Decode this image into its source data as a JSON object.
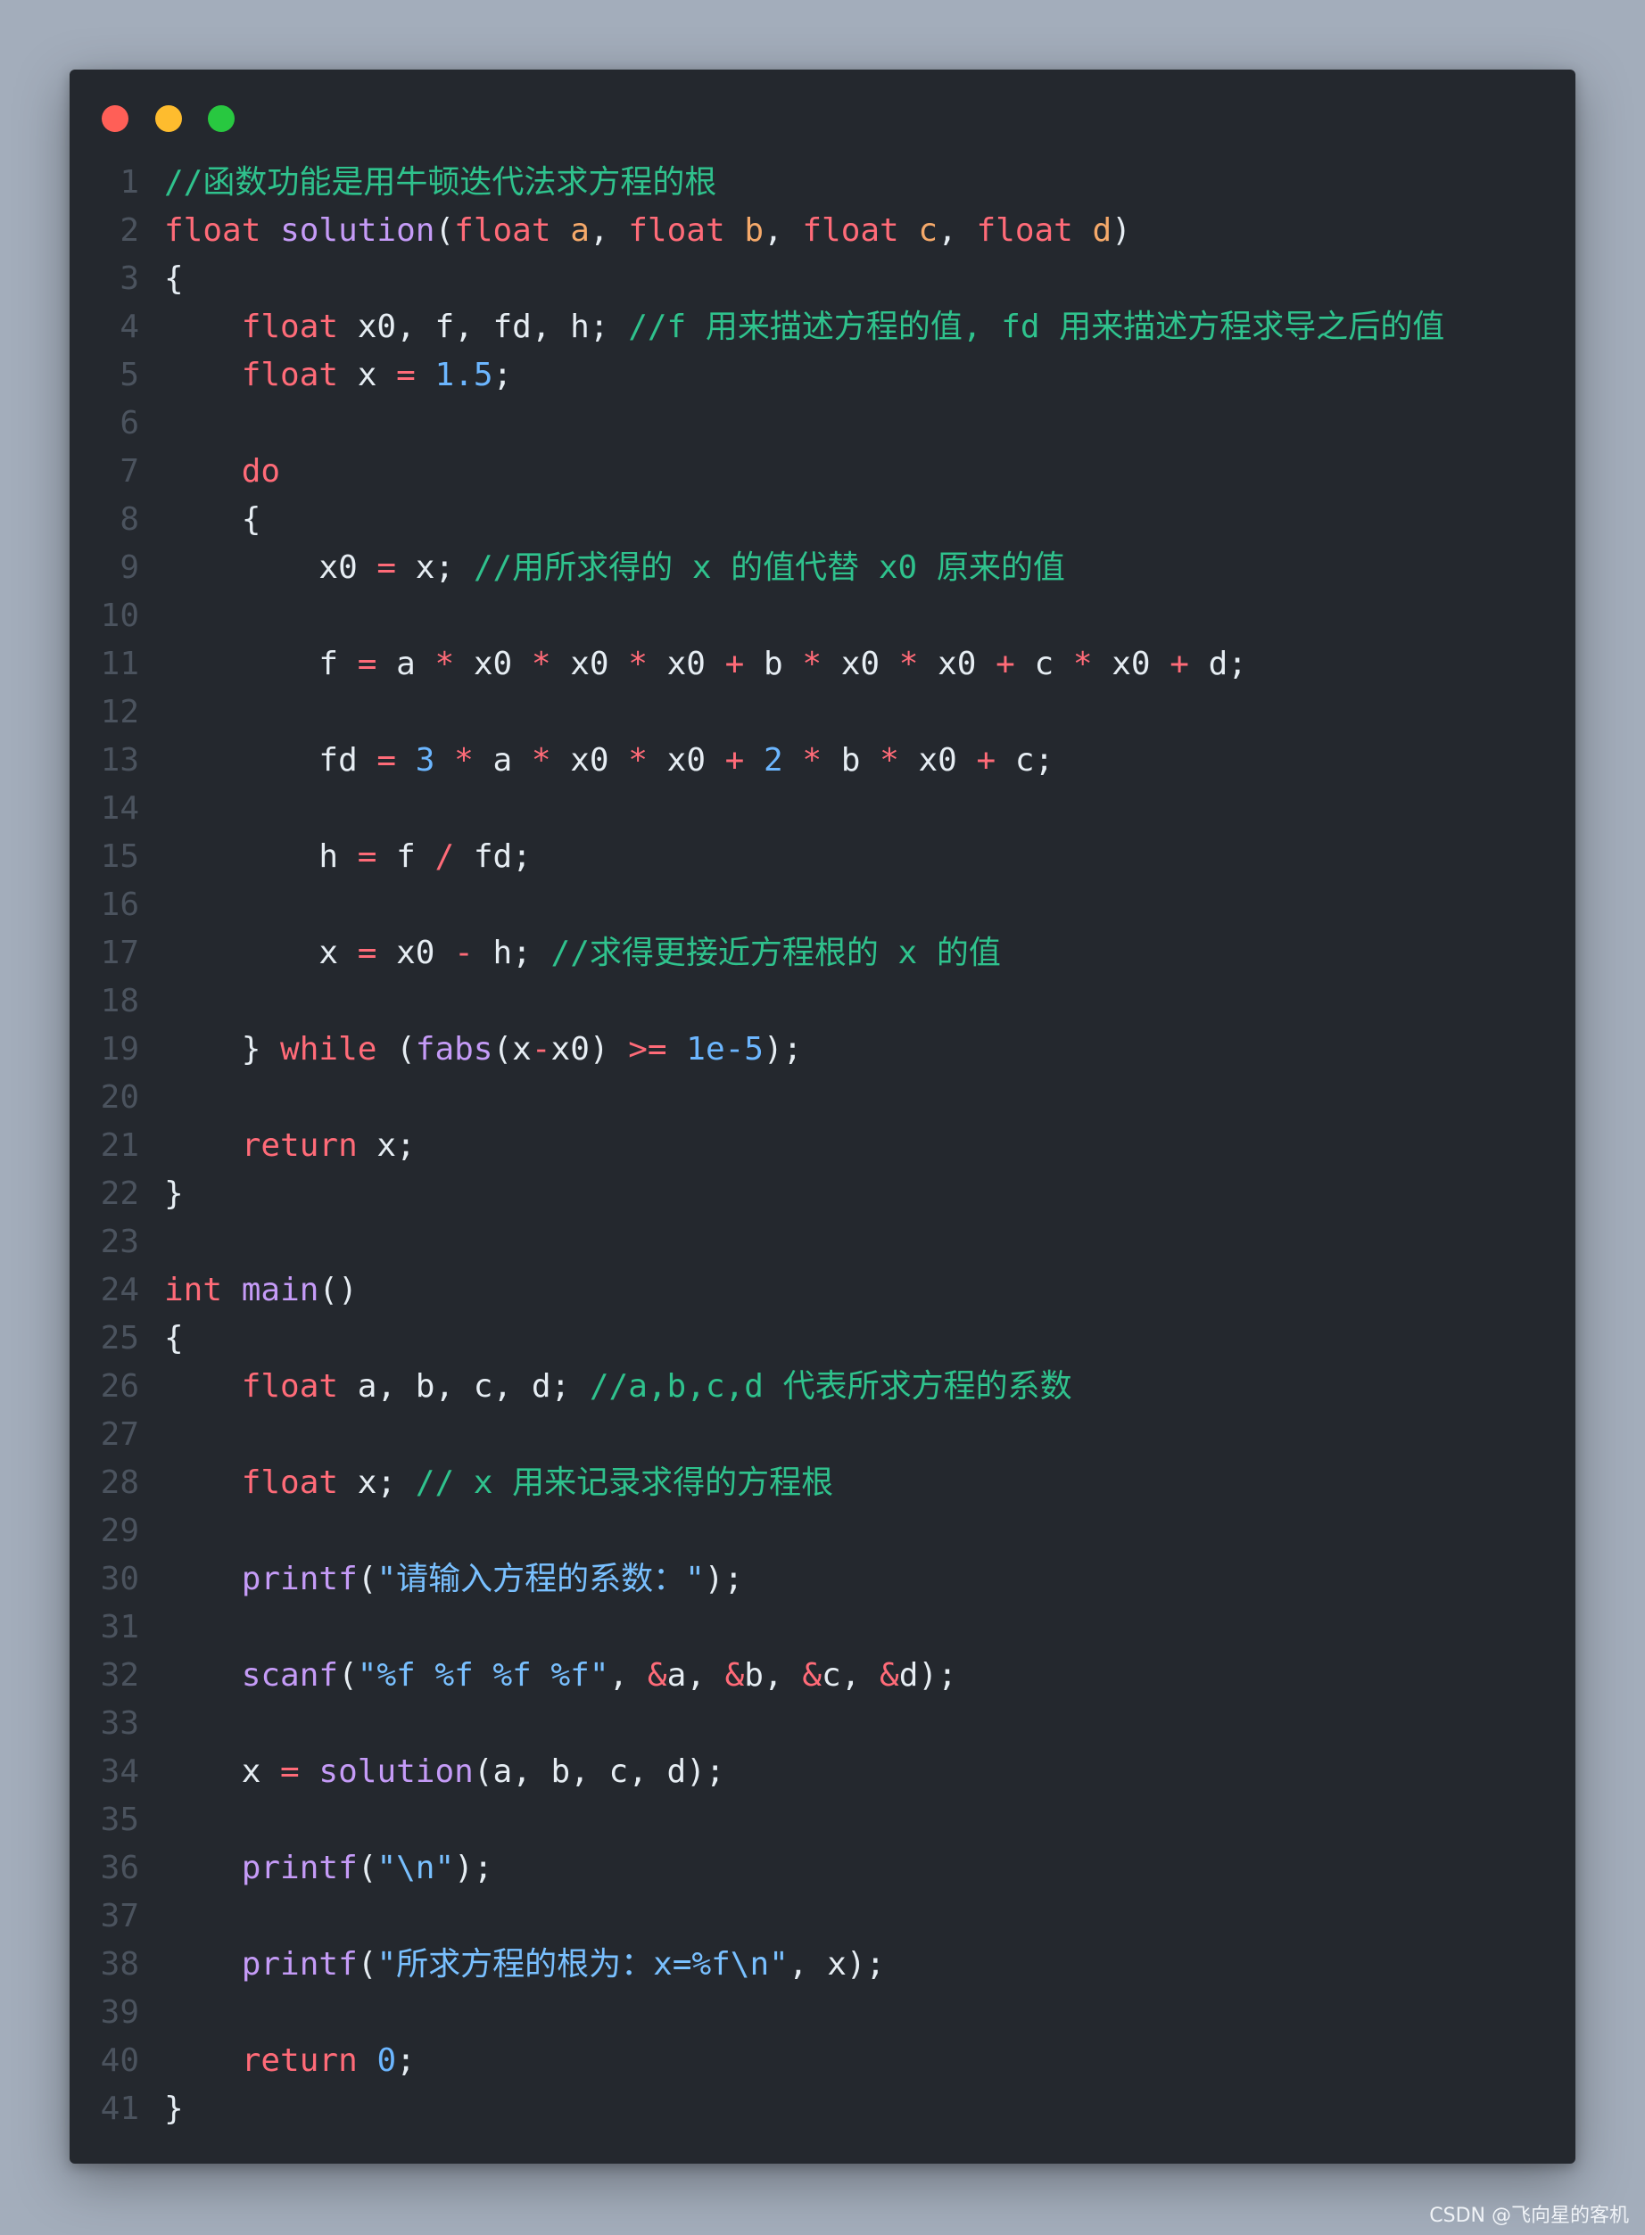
{
  "window": {
    "controls": [
      "close",
      "minimize",
      "maximize"
    ]
  },
  "code_lines": [
    [
      {
        "t": "//函数功能是用牛顿迭代法求方程的根",
        "c": "cm"
      }
    ],
    [
      {
        "t": "float",
        "c": "kw"
      },
      {
        "t": " ",
        "c": "plain"
      },
      {
        "t": "solution",
        "c": "fn"
      },
      {
        "t": "(",
        "c": "plain"
      },
      {
        "t": "float",
        "c": "kw"
      },
      {
        "t": " ",
        "c": "plain"
      },
      {
        "t": "a",
        "c": "param"
      },
      {
        "t": ", ",
        "c": "plain"
      },
      {
        "t": "float",
        "c": "kw"
      },
      {
        "t": " ",
        "c": "plain"
      },
      {
        "t": "b",
        "c": "param"
      },
      {
        "t": ", ",
        "c": "plain"
      },
      {
        "t": "float",
        "c": "kw"
      },
      {
        "t": " ",
        "c": "plain"
      },
      {
        "t": "c",
        "c": "param"
      },
      {
        "t": ", ",
        "c": "plain"
      },
      {
        "t": "float",
        "c": "kw"
      },
      {
        "t": " ",
        "c": "plain"
      },
      {
        "t": "d",
        "c": "param"
      },
      {
        "t": ")",
        "c": "plain"
      }
    ],
    [
      {
        "t": "{",
        "c": "plain"
      }
    ],
    [
      {
        "t": "    ",
        "c": "plain"
      },
      {
        "t": "float",
        "c": "kw"
      },
      {
        "t": " x0, f, fd, h; ",
        "c": "plain"
      },
      {
        "t": "//f 用来描述方程的值, fd 用来描述方程求导之后的值",
        "c": "cm"
      }
    ],
    [
      {
        "t": "    ",
        "c": "plain"
      },
      {
        "t": "float",
        "c": "kw"
      },
      {
        "t": " x ",
        "c": "plain"
      },
      {
        "t": "=",
        "c": "op"
      },
      {
        "t": " ",
        "c": "plain"
      },
      {
        "t": "1.5",
        "c": "num"
      },
      {
        "t": ";",
        "c": "plain"
      }
    ],
    [],
    [
      {
        "t": "    ",
        "c": "plain"
      },
      {
        "t": "do",
        "c": "kw"
      }
    ],
    [
      {
        "t": "    {",
        "c": "plain"
      }
    ],
    [
      {
        "t": "        x0 ",
        "c": "plain"
      },
      {
        "t": "=",
        "c": "op"
      },
      {
        "t": " x; ",
        "c": "plain"
      },
      {
        "t": "//用所求得的 x 的值代替 x0 原来的值",
        "c": "cm"
      }
    ],
    [],
    [
      {
        "t": "        f ",
        "c": "plain"
      },
      {
        "t": "=",
        "c": "op"
      },
      {
        "t": " a ",
        "c": "plain"
      },
      {
        "t": "*",
        "c": "op"
      },
      {
        "t": " x0 ",
        "c": "plain"
      },
      {
        "t": "*",
        "c": "op"
      },
      {
        "t": " x0 ",
        "c": "plain"
      },
      {
        "t": "*",
        "c": "op"
      },
      {
        "t": " x0 ",
        "c": "plain"
      },
      {
        "t": "+",
        "c": "op"
      },
      {
        "t": " b ",
        "c": "plain"
      },
      {
        "t": "*",
        "c": "op"
      },
      {
        "t": " x0 ",
        "c": "plain"
      },
      {
        "t": "*",
        "c": "op"
      },
      {
        "t": " x0 ",
        "c": "plain"
      },
      {
        "t": "+",
        "c": "op"
      },
      {
        "t": " c ",
        "c": "plain"
      },
      {
        "t": "*",
        "c": "op"
      },
      {
        "t": " x0 ",
        "c": "plain"
      },
      {
        "t": "+",
        "c": "op"
      },
      {
        "t": " d;",
        "c": "plain"
      }
    ],
    [],
    [
      {
        "t": "        fd ",
        "c": "plain"
      },
      {
        "t": "=",
        "c": "op"
      },
      {
        "t": " ",
        "c": "plain"
      },
      {
        "t": "3",
        "c": "num"
      },
      {
        "t": " ",
        "c": "plain"
      },
      {
        "t": "*",
        "c": "op"
      },
      {
        "t": " a ",
        "c": "plain"
      },
      {
        "t": "*",
        "c": "op"
      },
      {
        "t": " x0 ",
        "c": "plain"
      },
      {
        "t": "*",
        "c": "op"
      },
      {
        "t": " x0 ",
        "c": "plain"
      },
      {
        "t": "+",
        "c": "op"
      },
      {
        "t": " ",
        "c": "plain"
      },
      {
        "t": "2",
        "c": "num"
      },
      {
        "t": " ",
        "c": "plain"
      },
      {
        "t": "*",
        "c": "op"
      },
      {
        "t": " b ",
        "c": "plain"
      },
      {
        "t": "*",
        "c": "op"
      },
      {
        "t": " x0 ",
        "c": "plain"
      },
      {
        "t": "+",
        "c": "op"
      },
      {
        "t": " c;",
        "c": "plain"
      }
    ],
    [],
    [
      {
        "t": "        h ",
        "c": "plain"
      },
      {
        "t": "=",
        "c": "op"
      },
      {
        "t": " f ",
        "c": "plain"
      },
      {
        "t": "/",
        "c": "op"
      },
      {
        "t": " fd;",
        "c": "plain"
      }
    ],
    [],
    [
      {
        "t": "        x ",
        "c": "plain"
      },
      {
        "t": "=",
        "c": "op"
      },
      {
        "t": " x0 ",
        "c": "plain"
      },
      {
        "t": "-",
        "c": "op"
      },
      {
        "t": " h; ",
        "c": "plain"
      },
      {
        "t": "//求得更接近方程根的 x 的值",
        "c": "cm"
      }
    ],
    [],
    [
      {
        "t": "    } ",
        "c": "plain"
      },
      {
        "t": "while",
        "c": "kw"
      },
      {
        "t": " (",
        "c": "plain"
      },
      {
        "t": "fabs",
        "c": "fn"
      },
      {
        "t": "(x",
        "c": "plain"
      },
      {
        "t": "-",
        "c": "op"
      },
      {
        "t": "x0) ",
        "c": "plain"
      },
      {
        "t": ">=",
        "c": "op"
      },
      {
        "t": " ",
        "c": "plain"
      },
      {
        "t": "1e-5",
        "c": "num"
      },
      {
        "t": ");",
        "c": "plain"
      }
    ],
    [],
    [
      {
        "t": "    ",
        "c": "plain"
      },
      {
        "t": "return",
        "c": "kw"
      },
      {
        "t": " x;",
        "c": "plain"
      }
    ],
    [
      {
        "t": "}",
        "c": "plain"
      }
    ],
    [],
    [
      {
        "t": "int",
        "c": "kw"
      },
      {
        "t": " ",
        "c": "plain"
      },
      {
        "t": "main",
        "c": "fn"
      },
      {
        "t": "()",
        "c": "plain"
      }
    ],
    [
      {
        "t": "{",
        "c": "plain"
      }
    ],
    [
      {
        "t": "    ",
        "c": "plain"
      },
      {
        "t": "float",
        "c": "kw"
      },
      {
        "t": " a, b, c, d; ",
        "c": "plain"
      },
      {
        "t": "//a,b,c,d 代表所求方程的系数",
        "c": "cm"
      }
    ],
    [],
    [
      {
        "t": "    ",
        "c": "plain"
      },
      {
        "t": "float",
        "c": "kw"
      },
      {
        "t": " x; ",
        "c": "plain"
      },
      {
        "t": "// x 用来记录求得的方程根",
        "c": "cm"
      }
    ],
    [],
    [
      {
        "t": "    ",
        "c": "plain"
      },
      {
        "t": "printf",
        "c": "fn"
      },
      {
        "t": "(",
        "c": "plain"
      },
      {
        "t": "\"请输入方程的系数：\"",
        "c": "str"
      },
      {
        "t": ");",
        "c": "plain"
      }
    ],
    [],
    [
      {
        "t": "    ",
        "c": "plain"
      },
      {
        "t": "scanf",
        "c": "fn"
      },
      {
        "t": "(",
        "c": "plain"
      },
      {
        "t": "\"%f %f %f %f\"",
        "c": "str"
      },
      {
        "t": ", ",
        "c": "plain"
      },
      {
        "t": "&",
        "c": "op"
      },
      {
        "t": "a, ",
        "c": "plain"
      },
      {
        "t": "&",
        "c": "op"
      },
      {
        "t": "b, ",
        "c": "plain"
      },
      {
        "t": "&",
        "c": "op"
      },
      {
        "t": "c, ",
        "c": "plain"
      },
      {
        "t": "&",
        "c": "op"
      },
      {
        "t": "d);",
        "c": "plain"
      }
    ],
    [],
    [
      {
        "t": "    x ",
        "c": "plain"
      },
      {
        "t": "=",
        "c": "op"
      },
      {
        "t": " ",
        "c": "plain"
      },
      {
        "t": "solution",
        "c": "fn"
      },
      {
        "t": "(a, b, c, d);",
        "c": "plain"
      }
    ],
    [],
    [
      {
        "t": "    ",
        "c": "plain"
      },
      {
        "t": "printf",
        "c": "fn"
      },
      {
        "t": "(",
        "c": "plain"
      },
      {
        "t": "\"\\n\"",
        "c": "str"
      },
      {
        "t": ");",
        "c": "plain"
      }
    ],
    [],
    [
      {
        "t": "    ",
        "c": "plain"
      },
      {
        "t": "printf",
        "c": "fn"
      },
      {
        "t": "(",
        "c": "plain"
      },
      {
        "t": "\"所求方程的根为：x=%f\\n\"",
        "c": "str"
      },
      {
        "t": ", x);",
        "c": "plain"
      }
    ],
    [],
    [
      {
        "t": "    ",
        "c": "plain"
      },
      {
        "t": "return",
        "c": "kw"
      },
      {
        "t": " ",
        "c": "plain"
      },
      {
        "t": "0",
        "c": "num"
      },
      {
        "t": ";",
        "c": "plain"
      }
    ],
    [
      {
        "t": "}",
        "c": "plain"
      }
    ]
  ],
  "watermark": "CSDN @飞向星的客机",
  "colors": {
    "background": "#a3adbb",
    "editor_bg": "#24282e",
    "keyword": "#ff6b78",
    "function": "#c59bf7",
    "parameter": "#f5a96a",
    "number": "#6cb6ff",
    "comment": "#2fc28d",
    "string": "#79c0ff",
    "text": "#e6edf3",
    "line_number": "#4b535e"
  }
}
